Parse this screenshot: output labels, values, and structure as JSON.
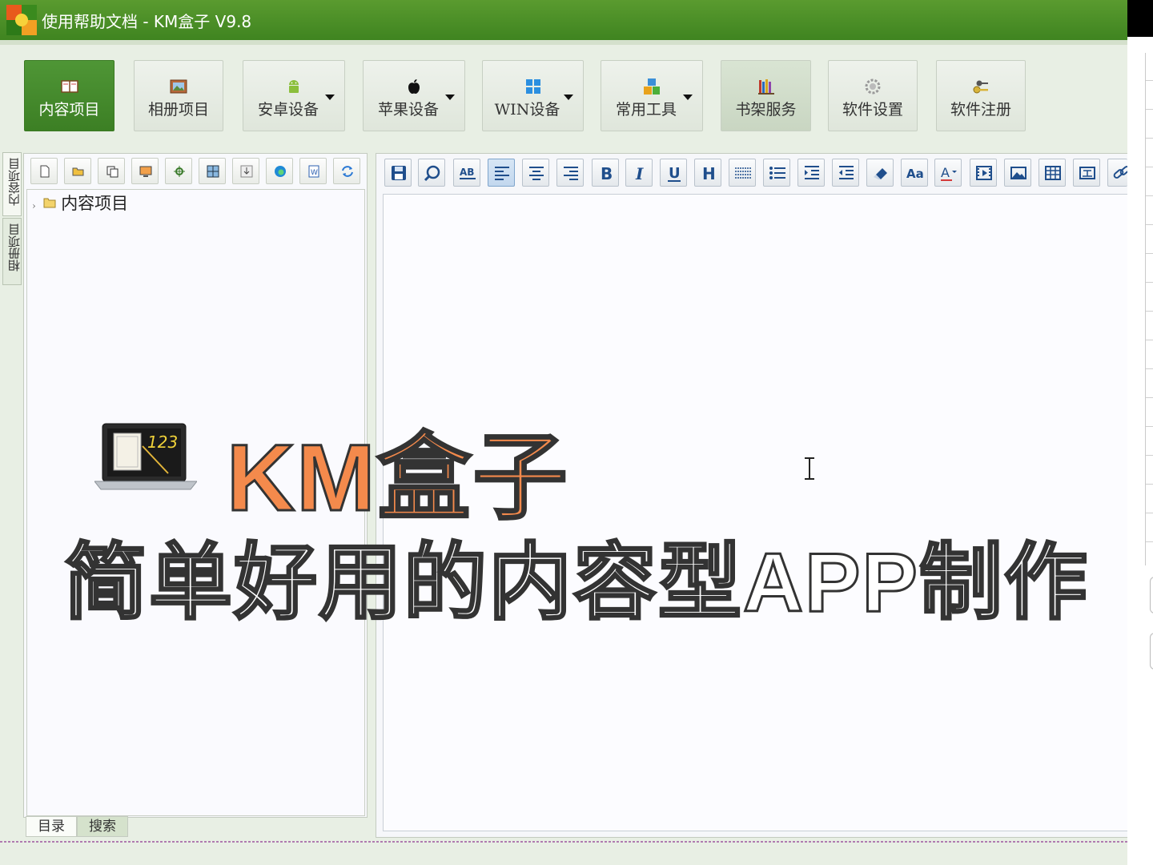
{
  "window": {
    "title": "使用帮助文档 - KM盒子 V9.8"
  },
  "ribbon": {
    "buttons": [
      {
        "label": "内容项目",
        "icon": "book-icon",
        "state": "active"
      },
      {
        "label": "相册项目",
        "icon": "picture-icon"
      },
      {
        "label": "安卓设备",
        "icon": "android-icon",
        "dropdown": true
      },
      {
        "label": "苹果设备",
        "icon": "apple-icon",
        "dropdown": true
      },
      {
        "label": "WIN设备",
        "icon": "windows-icon",
        "dropdown": true
      },
      {
        "label": "常用工具",
        "icon": "blocks-icon",
        "dropdown": true
      },
      {
        "label": "书架服务",
        "icon": "bookshelf-icon",
        "state": "hover"
      },
      {
        "label": "软件设置",
        "icon": "gear-icon"
      },
      {
        "label": "软件注册",
        "icon": "keys-icon"
      }
    ]
  },
  "side_tabs": [
    "内容项目",
    "相册项目"
  ],
  "tree": {
    "root_label": "内容项目"
  },
  "bottom_tabs": [
    "目录",
    "搜索"
  ],
  "promo": {
    "title": "KM盒子",
    "laptop_number": "123",
    "subtitle": "简单好用的内容型APP制作"
  },
  "colors": {
    "titlebar": "#4a8e28",
    "active_button": "#469030",
    "promo_orange": "#f48a4c"
  }
}
